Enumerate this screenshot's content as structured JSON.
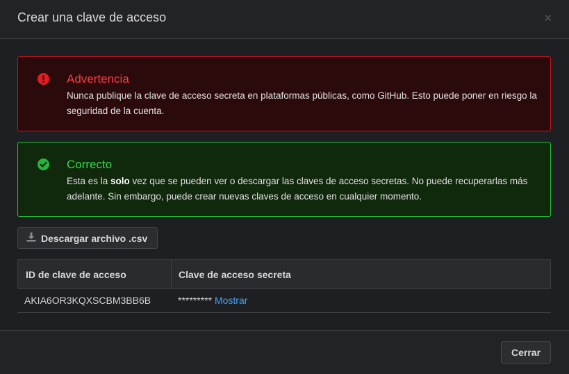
{
  "dialog": {
    "title": "Crear una clave de acceso",
    "close_glyph": "×"
  },
  "warning": {
    "title": "Advertencia",
    "body": "Nunca publique la clave de acceso secreta en plataformas públicas, como GitHub. Esto puede poner en riesgo la seguridad de la cuenta.",
    "icon": "exclamation-circle-icon",
    "color": "#ff3b40"
  },
  "success": {
    "title": "Correcto",
    "body_before": "Esta es la ",
    "body_bold": "solo",
    "body_after": " vez que se pueden ver o descargar las claves de acceso secretas. No puede recuperarlas más adelante. Sin embargo, puede crear nuevas claves de acceso en cualquier momento.",
    "icon": "check-circle-icon",
    "color": "#35d84f"
  },
  "download": {
    "label": "Descargar archivo .csv",
    "icon": "download-icon"
  },
  "table": {
    "headers": [
      "ID de clave de acceso",
      "Clave de acceso secreta"
    ],
    "rows": [
      {
        "access_key_id": "AKIA6OR3KQXSCBM3BB6B",
        "secret_masked": "*********",
        "show_label": "Mostrar"
      }
    ]
  },
  "footer": {
    "close_label": "Cerrar"
  },
  "colors": {
    "link": "#3fa4ff",
    "danger_border": "#c4161c",
    "success_border": "#1fbf3a"
  }
}
